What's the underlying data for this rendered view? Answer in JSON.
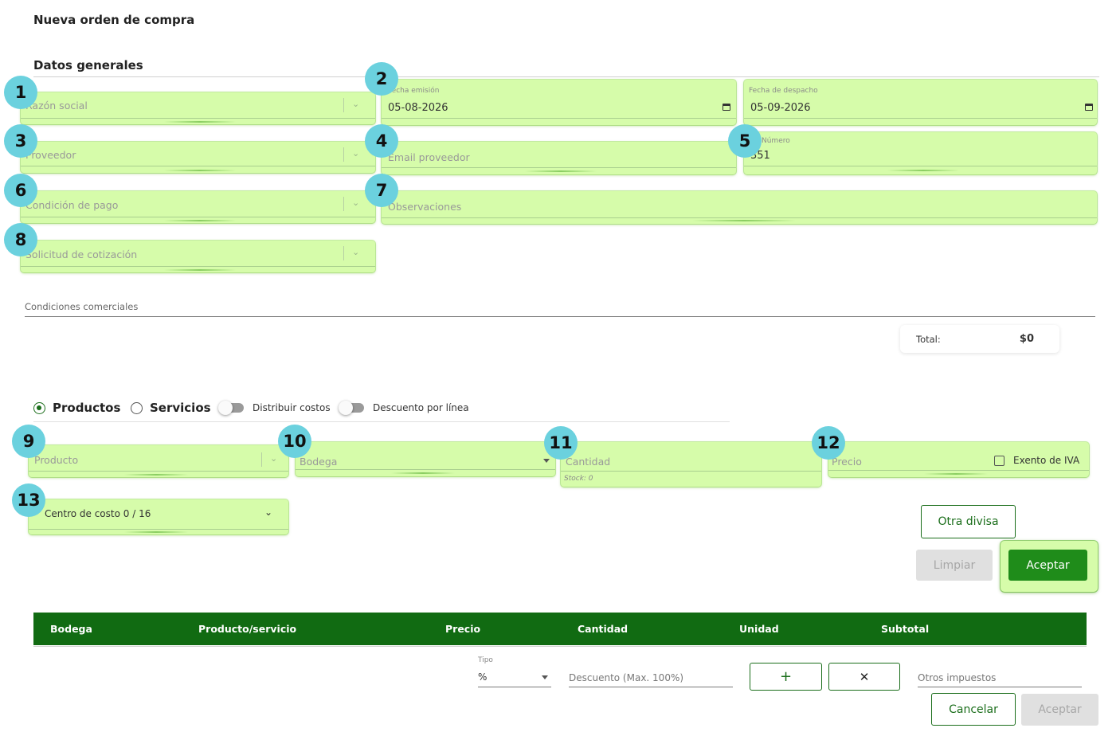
{
  "page": {
    "title": "Nueva orden de compra"
  },
  "general": {
    "section_title": "Datos generales",
    "razon_social_placeholder": "Razón social",
    "fecha_emision_label": "Fecha emisión",
    "fecha_emision_value": "05-08-2026",
    "fecha_despacho_label": "Fecha de despacho",
    "fecha_despacho_value": "05-09-2026",
    "proveedor_placeholder": "Proveedor",
    "email_placeholder": "Email proveedor",
    "numero_label": "Número",
    "numero_value": "351",
    "condicion_pago_placeholder": "Condición de pago",
    "observaciones_placeholder": "Observaciones",
    "solicitud_placeholder": "Solicitud de cotización"
  },
  "conditions": {
    "label": "Condiciones comerciales"
  },
  "total": {
    "label": "Total:",
    "value": "$0"
  },
  "item_type": {
    "productos_label": "Productos",
    "servicios_label": "Servicios",
    "selected": "Productos",
    "distribuir_label": "Distribuir costos",
    "descuento_linea_label": "Descuento por línea"
  },
  "item_form": {
    "producto_placeholder": "Producto",
    "bodega_placeholder": "Bodega",
    "cantidad_placeholder": "Cantidad",
    "stock_hint": "Stock: 0",
    "precio_placeholder": "Precio",
    "exento_label": "Exento de IVA",
    "centro_costo_value": "Centro de costo 0 / 16",
    "otra_divisa_label": "Otra divisa",
    "limpiar_label": "Limpiar",
    "aceptar_label": "Aceptar"
  },
  "table": {
    "columns": [
      "Bodega",
      "Producto/servicio",
      "Precio",
      "Cantidad",
      "Unidad",
      "Subtotal"
    ]
  },
  "discount": {
    "tipo_label": "Tipo",
    "tipo_value": "%",
    "descuento_placeholder": "Descuento (Max. 100%)",
    "add_symbol": "+",
    "remove_symbol": "✕",
    "otros_impuestos_placeholder": "Otros impuestos"
  },
  "footer": {
    "cancelar_label": "Cancelar",
    "aceptar_label": "Aceptar"
  },
  "badges": [
    "1",
    "2",
    "3",
    "4",
    "5",
    "6",
    "7",
    "8",
    "9",
    "10",
    "11",
    "12",
    "13"
  ],
  "colors": {
    "primary_green": "#116b12",
    "button_green": "#1f8c1a",
    "highlight": "#d6fcaa",
    "badge": "#6bd1de"
  }
}
